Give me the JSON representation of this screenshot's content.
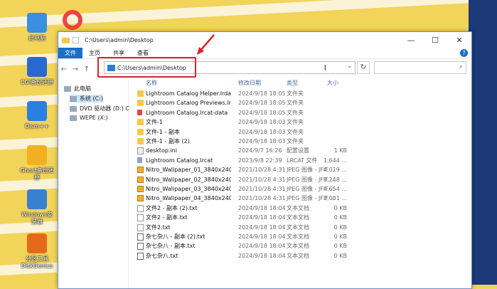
{
  "desktop": {
    "icons": [
      {
        "label": "此电脑",
        "icon": "computer-icon",
        "color": "#3a8fe0"
      },
      {
        "label": "CGI备份还原",
        "icon": "cgi-backup-icon",
        "color": "#2a6ad0"
      },
      {
        "label": "Dism++",
        "icon": "dism-icon",
        "color": "#2a80e0"
      },
      {
        "label": "Ghost备份还原",
        "icon": "ghost-icon",
        "color": "#f0b020"
      },
      {
        "label": "Windows安装器",
        "icon": "windows-installer-icon",
        "color": "#3a7fd0"
      },
      {
        "label": "分区工具DiskGenius",
        "icon": "diskgenius-icon",
        "color": "#e46a1a"
      }
    ]
  },
  "window": {
    "title": "C:\\Users\\admin\\Desktop",
    "controls": {
      "minimize": "—",
      "maximize": "☐",
      "close": "✕"
    },
    "ribbon_tabs": [
      "文件",
      "主页",
      "共享",
      "查看"
    ],
    "help": "?",
    "address": "C:\\Users\\admin\\Desktop",
    "nav": {
      "back": "←",
      "forward": "→",
      "up": "↑"
    }
  },
  "nav_pane": [
    {
      "label": "此电脑",
      "icon": "computer-icon"
    },
    {
      "label": "系统 (C:)",
      "icon": "drive-icon",
      "selected": true
    },
    {
      "label": "DVD 驱动器 (D:) C",
      "icon": "dvd-icon"
    },
    {
      "label": "WEPE (X:)",
      "icon": "drive-icon"
    }
  ],
  "columns": {
    "name": "名称",
    "date": "修改日期",
    "type": "类型",
    "size": "大小"
  },
  "files": [
    {
      "name": "Lightroom Catalog Helper.lrdata",
      "date": "2024/9/18 18:05",
      "type": "文件夹",
      "size": "",
      "kind": "folder"
    },
    {
      "name": "Lightroom Catalog Previews.lr...",
      "date": "2024/9/18 18:05",
      "type": "文件夹",
      "size": "",
      "kind": "folder"
    },
    {
      "name": "Lightroom Catalog.lrcat-data",
      "date": "2024/9/18 18:05",
      "type": "文件夹",
      "size": "",
      "kind": "lr"
    },
    {
      "name": "文件-1",
      "date": "2024/9/18 18:03",
      "type": "文件夹",
      "size": "",
      "kind": "folder"
    },
    {
      "name": "文件-1 - 副本",
      "date": "2024/9/18 18:03",
      "type": "文件夹",
      "size": "",
      "kind": "folder"
    },
    {
      "name": "文件-1 - 副本 (2)",
      "date": "2024/9/18 18:03",
      "type": "文件夹",
      "size": "",
      "kind": "folder"
    },
    {
      "name": "desktop.ini",
      "date": "2024/9/7 16:26",
      "type": "配置设置",
      "size": "1 KB",
      "kind": "ini"
    },
    {
      "name": "Lightroom Catalog.lrcat",
      "date": "2023/9/8 22:39",
      "type": "LRCAT 文件",
      "size": "1,644 ...",
      "kind": "cat"
    },
    {
      "name": "Nitro_Wallpaper_01_3840x2400...",
      "date": "2021/10/28 4:31",
      "type": "JPEG 图像 - JFIF ...",
      "size": "4,019 ...",
      "kind": "jpg"
    },
    {
      "name": "Nitro_Wallpaper_02_3840x2400...",
      "date": "2021/10/28 4:31",
      "type": "JPEG 图像 - JFIF ...",
      "size": "3,248 ...",
      "kind": "jpg"
    },
    {
      "name": "Nitro_Wallpaper_03_3840x2400...",
      "date": "2021/10/28 4:31",
      "type": "JPEG 图像 - JFIF ...",
      "size": "4,654 ...",
      "kind": "jpg"
    },
    {
      "name": "Nitro_Wallpaper_04_3840x2400...",
      "date": "2021/10/28 4:31",
      "type": "JPEG 图像 - JFIF ...",
      "size": "3,081 ...",
      "kind": "jpg"
    },
    {
      "name": "文件2 - 副本 (2).txt",
      "date": "2024/9/18 18:04",
      "type": "文本文档",
      "size": "0 KB",
      "kind": "txt"
    },
    {
      "name": "文件2 - 副本.txt",
      "date": "2024/9/18 18:04",
      "type": "文本文档",
      "size": "0 KB",
      "kind": "txt"
    },
    {
      "name": "文件2.txt",
      "date": "2024/9/18 18:04",
      "type": "文本文档",
      "size": "0 KB",
      "kind": "txt"
    },
    {
      "name": "杂七杂八 - 副本 (2).txt",
      "date": "2024/9/18 18:04",
      "type": "文本文档",
      "size": "0 KB",
      "kind": "doc"
    },
    {
      "name": "杂七杂八 - 副本.txt",
      "date": "2024/9/18 18:04",
      "type": "文本文档",
      "size": "0 KB",
      "kind": "doc"
    },
    {
      "name": "杂七杂八.txt",
      "date": "2024/9/18 18:04",
      "type": "文本文档",
      "size": "0 KB",
      "kind": "doc"
    }
  ]
}
